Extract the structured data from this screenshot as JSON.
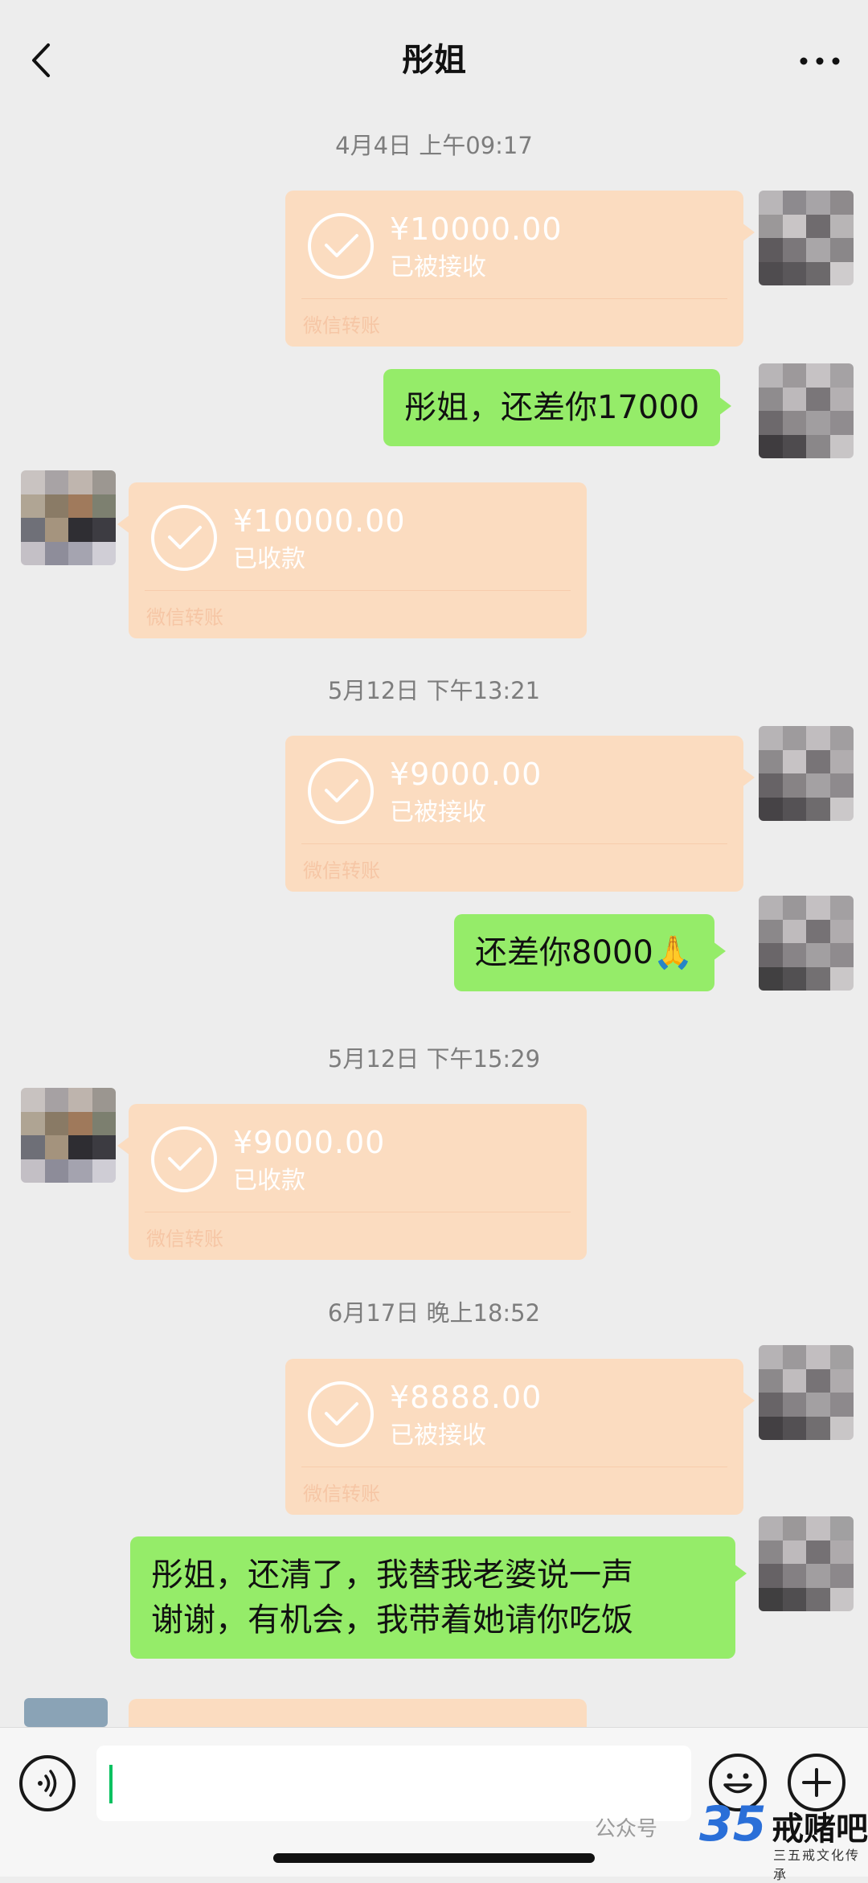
{
  "header": {
    "title": "彤姐"
  },
  "timestamps": [
    "4月4日 上午09:17",
    "5月12日 下午13:21",
    "5月12日 下午15:29",
    "6月17日 晚上18:52"
  ],
  "transfers": [
    {
      "amount": "¥10000.00",
      "status": "已被接收",
      "footer": "微信转账"
    },
    {
      "amount": "¥10000.00",
      "status": "已收款",
      "footer": "微信转账"
    },
    {
      "amount": "¥9000.00",
      "status": "已被接收",
      "footer": "微信转账"
    },
    {
      "amount": "¥9000.00",
      "status": "已收款",
      "footer": "微信转账"
    },
    {
      "amount": "¥8888.00",
      "status": "已被接收",
      "footer": "微信转账"
    }
  ],
  "messages": {
    "m1": "彤姐，还差你17000",
    "m2": "还差你8000🙏",
    "m3_line1": "彤姐，还清了，我替我老婆说一声",
    "m3_line2": "谢谢，有机会，我带着她请你吃饭"
  },
  "watermark": {
    "label": "公众号",
    "number": "35",
    "brand": "戒赌吧",
    "sub": "三五戒文化传承"
  },
  "colors": {
    "background": "#ededed",
    "sent_bubble": "#95ec69",
    "transfer_bubble": "#fbdcc0",
    "caret": "#07c160"
  }
}
